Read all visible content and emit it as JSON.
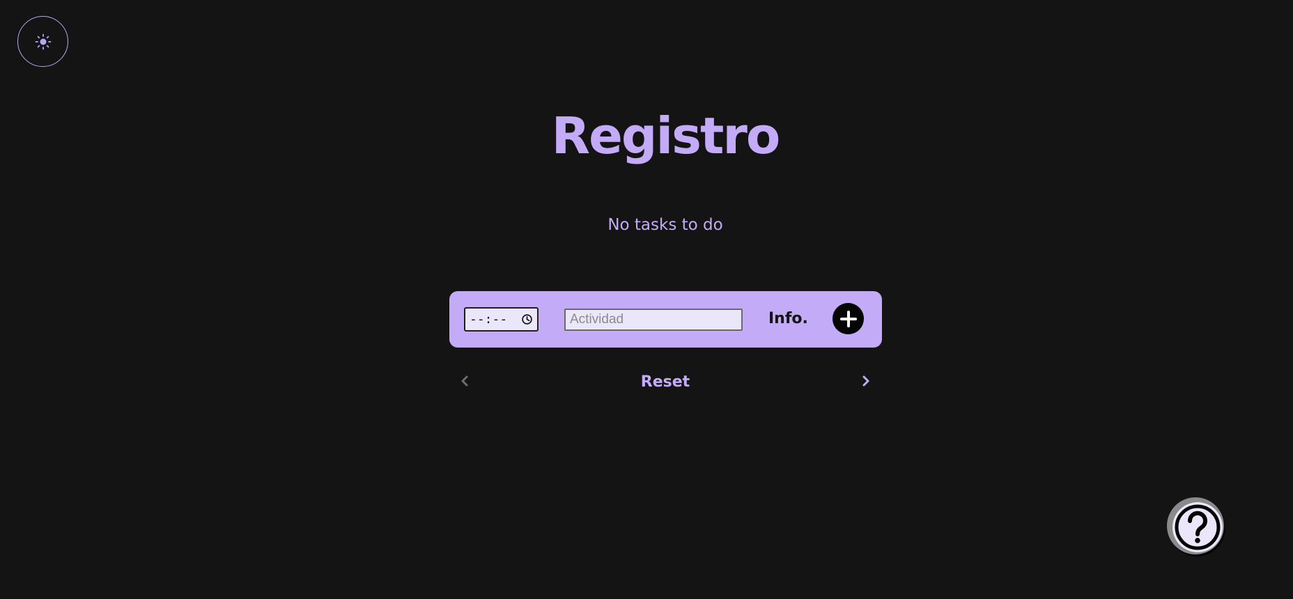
{
  "header": {
    "theme_toggle_icon": "sun-icon"
  },
  "main": {
    "title": "Registro",
    "empty_message": "No tasks to do"
  },
  "task_form": {
    "time_value": "--:--",
    "time_icon": "clock-icon",
    "activity_placeholder": "Actividad",
    "activity_value": "",
    "info_label": "Info.",
    "add_icon": "plus-icon"
  },
  "pagination": {
    "prev_icon": "chevron-left-icon",
    "reset_label": "Reset",
    "next_icon": "chevron-right-icon"
  },
  "help": {
    "icon": "question-icon"
  },
  "colors": {
    "background": "#141414",
    "accent": "#c4abf7",
    "input_bg": "#ece6fb",
    "dark": "#050505"
  }
}
